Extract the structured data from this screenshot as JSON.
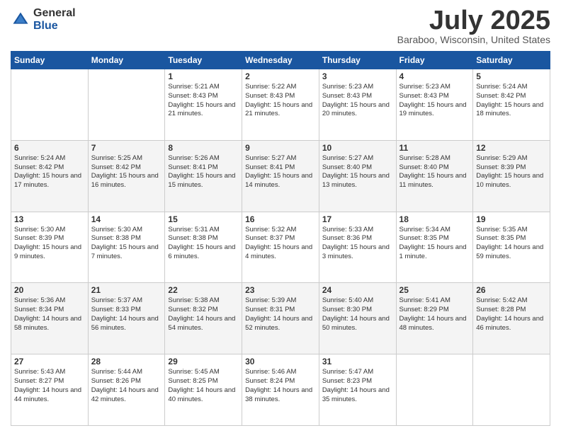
{
  "header": {
    "logo_general": "General",
    "logo_blue": "Blue",
    "title": "July 2025",
    "location": "Baraboo, Wisconsin, United States"
  },
  "days_of_week": [
    "Sunday",
    "Monday",
    "Tuesday",
    "Wednesday",
    "Thursday",
    "Friday",
    "Saturday"
  ],
  "weeks": [
    [
      {
        "day": "",
        "info": ""
      },
      {
        "day": "",
        "info": ""
      },
      {
        "day": "1",
        "info": "Sunrise: 5:21 AM\nSunset: 8:43 PM\nDaylight: 15 hours and 21 minutes."
      },
      {
        "day": "2",
        "info": "Sunrise: 5:22 AM\nSunset: 8:43 PM\nDaylight: 15 hours and 21 minutes."
      },
      {
        "day": "3",
        "info": "Sunrise: 5:23 AM\nSunset: 8:43 PM\nDaylight: 15 hours and 20 minutes."
      },
      {
        "day": "4",
        "info": "Sunrise: 5:23 AM\nSunset: 8:43 PM\nDaylight: 15 hours and 19 minutes."
      },
      {
        "day": "5",
        "info": "Sunrise: 5:24 AM\nSunset: 8:42 PM\nDaylight: 15 hours and 18 minutes."
      }
    ],
    [
      {
        "day": "6",
        "info": "Sunrise: 5:24 AM\nSunset: 8:42 PM\nDaylight: 15 hours and 17 minutes."
      },
      {
        "day": "7",
        "info": "Sunrise: 5:25 AM\nSunset: 8:42 PM\nDaylight: 15 hours and 16 minutes."
      },
      {
        "day": "8",
        "info": "Sunrise: 5:26 AM\nSunset: 8:41 PM\nDaylight: 15 hours and 15 minutes."
      },
      {
        "day": "9",
        "info": "Sunrise: 5:27 AM\nSunset: 8:41 PM\nDaylight: 15 hours and 14 minutes."
      },
      {
        "day": "10",
        "info": "Sunrise: 5:27 AM\nSunset: 8:40 PM\nDaylight: 15 hours and 13 minutes."
      },
      {
        "day": "11",
        "info": "Sunrise: 5:28 AM\nSunset: 8:40 PM\nDaylight: 15 hours and 11 minutes."
      },
      {
        "day": "12",
        "info": "Sunrise: 5:29 AM\nSunset: 8:39 PM\nDaylight: 15 hours and 10 minutes."
      }
    ],
    [
      {
        "day": "13",
        "info": "Sunrise: 5:30 AM\nSunset: 8:39 PM\nDaylight: 15 hours and 9 minutes."
      },
      {
        "day": "14",
        "info": "Sunrise: 5:30 AM\nSunset: 8:38 PM\nDaylight: 15 hours and 7 minutes."
      },
      {
        "day": "15",
        "info": "Sunrise: 5:31 AM\nSunset: 8:38 PM\nDaylight: 15 hours and 6 minutes."
      },
      {
        "day": "16",
        "info": "Sunrise: 5:32 AM\nSunset: 8:37 PM\nDaylight: 15 hours and 4 minutes."
      },
      {
        "day": "17",
        "info": "Sunrise: 5:33 AM\nSunset: 8:36 PM\nDaylight: 15 hours and 3 minutes."
      },
      {
        "day": "18",
        "info": "Sunrise: 5:34 AM\nSunset: 8:35 PM\nDaylight: 15 hours and 1 minute."
      },
      {
        "day": "19",
        "info": "Sunrise: 5:35 AM\nSunset: 8:35 PM\nDaylight: 14 hours and 59 minutes."
      }
    ],
    [
      {
        "day": "20",
        "info": "Sunrise: 5:36 AM\nSunset: 8:34 PM\nDaylight: 14 hours and 58 minutes."
      },
      {
        "day": "21",
        "info": "Sunrise: 5:37 AM\nSunset: 8:33 PM\nDaylight: 14 hours and 56 minutes."
      },
      {
        "day": "22",
        "info": "Sunrise: 5:38 AM\nSunset: 8:32 PM\nDaylight: 14 hours and 54 minutes."
      },
      {
        "day": "23",
        "info": "Sunrise: 5:39 AM\nSunset: 8:31 PM\nDaylight: 14 hours and 52 minutes."
      },
      {
        "day": "24",
        "info": "Sunrise: 5:40 AM\nSunset: 8:30 PM\nDaylight: 14 hours and 50 minutes."
      },
      {
        "day": "25",
        "info": "Sunrise: 5:41 AM\nSunset: 8:29 PM\nDaylight: 14 hours and 48 minutes."
      },
      {
        "day": "26",
        "info": "Sunrise: 5:42 AM\nSunset: 8:28 PM\nDaylight: 14 hours and 46 minutes."
      }
    ],
    [
      {
        "day": "27",
        "info": "Sunrise: 5:43 AM\nSunset: 8:27 PM\nDaylight: 14 hours and 44 minutes."
      },
      {
        "day": "28",
        "info": "Sunrise: 5:44 AM\nSunset: 8:26 PM\nDaylight: 14 hours and 42 minutes."
      },
      {
        "day": "29",
        "info": "Sunrise: 5:45 AM\nSunset: 8:25 PM\nDaylight: 14 hours and 40 minutes."
      },
      {
        "day": "30",
        "info": "Sunrise: 5:46 AM\nSunset: 8:24 PM\nDaylight: 14 hours and 38 minutes."
      },
      {
        "day": "31",
        "info": "Sunrise: 5:47 AM\nSunset: 8:23 PM\nDaylight: 14 hours and 35 minutes."
      },
      {
        "day": "",
        "info": ""
      },
      {
        "day": "",
        "info": ""
      }
    ]
  ]
}
